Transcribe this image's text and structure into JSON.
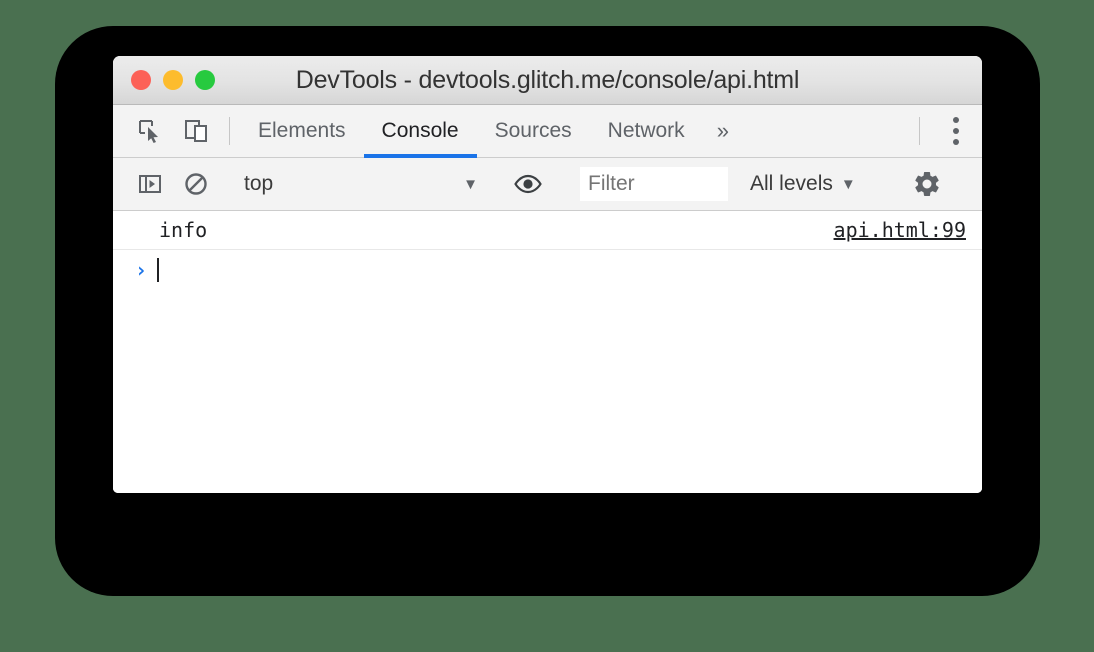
{
  "window": {
    "title": "DevTools - devtools.glitch.me/console/api.html",
    "traffic_lights": [
      {
        "name": "close",
        "color": "#fc6157"
      },
      {
        "name": "minimize",
        "color": "#fdbc2d"
      },
      {
        "name": "maximize",
        "color": "#27ca3f"
      }
    ]
  },
  "tabbar": {
    "icons": [
      {
        "name": "inspect-element-icon"
      },
      {
        "name": "device-toolbar-icon"
      }
    ],
    "tabs": [
      {
        "label": "Elements",
        "active": false
      },
      {
        "label": "Console",
        "active": true
      },
      {
        "label": "Sources",
        "active": false
      },
      {
        "label": "Network",
        "active": false
      }
    ],
    "more_tabs_label": "»",
    "active_tab": "Console",
    "accent_color": "#1a73e8",
    "menu_label": "Customize and control DevTools"
  },
  "toolbar": {
    "sidebar_toggle_name": "console-sidebar-icon",
    "clear_console_name": "clear-console-icon",
    "context_selector": {
      "value": "top",
      "caret": "▼"
    },
    "eye_icon_name": "create-live-expression-icon",
    "filter": {
      "value": "",
      "placeholder": "Filter"
    },
    "levels": {
      "label": "All levels",
      "caret": "▼"
    },
    "settings_icon_name": "gear-icon"
  },
  "console": {
    "messages": [
      {
        "text": "info",
        "source": "api.html:99"
      }
    ],
    "prompt": {
      "arrow": "›",
      "value": ""
    }
  },
  "background": {
    "page_color": "#4a7050",
    "slab_color": "#000000"
  }
}
